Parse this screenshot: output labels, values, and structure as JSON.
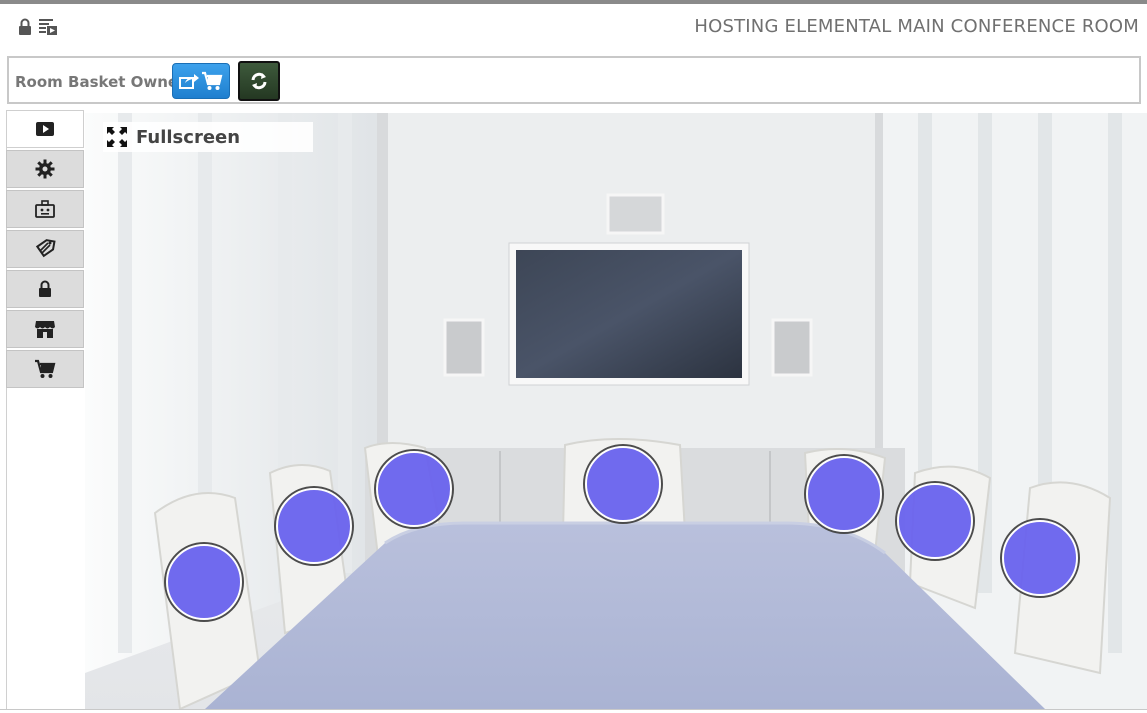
{
  "header": {
    "title": "HOSTING ELEMENTAL MAIN CONFERENCE ROOM",
    "icons": [
      "lock-icon",
      "list-play-icon"
    ]
  },
  "toolbar": {
    "label": "Room Basket Owner",
    "basket_button_icons": [
      "share-icon",
      "cart-icon"
    ],
    "refresh_button_icon": "refresh-icon"
  },
  "sidebar": {
    "items": [
      {
        "icon": "play-icon",
        "active": true
      },
      {
        "icon": "gear-icon",
        "active": false
      },
      {
        "icon": "id-badge-icon",
        "active": false
      },
      {
        "icon": "tags-icon",
        "active": false
      },
      {
        "icon": "lock-icon",
        "active": false
      },
      {
        "icon": "store-icon",
        "active": false
      },
      {
        "icon": "cart-icon",
        "active": false
      }
    ]
  },
  "scene": {
    "fullscreen_label": "Fullscreen",
    "seat_count": 7,
    "seat_color": "#6a63ee"
  },
  "colors": {
    "accent_blue": "#2b8de0",
    "refresh_green": "#2f4a2d",
    "seat": "#6a63ee"
  }
}
